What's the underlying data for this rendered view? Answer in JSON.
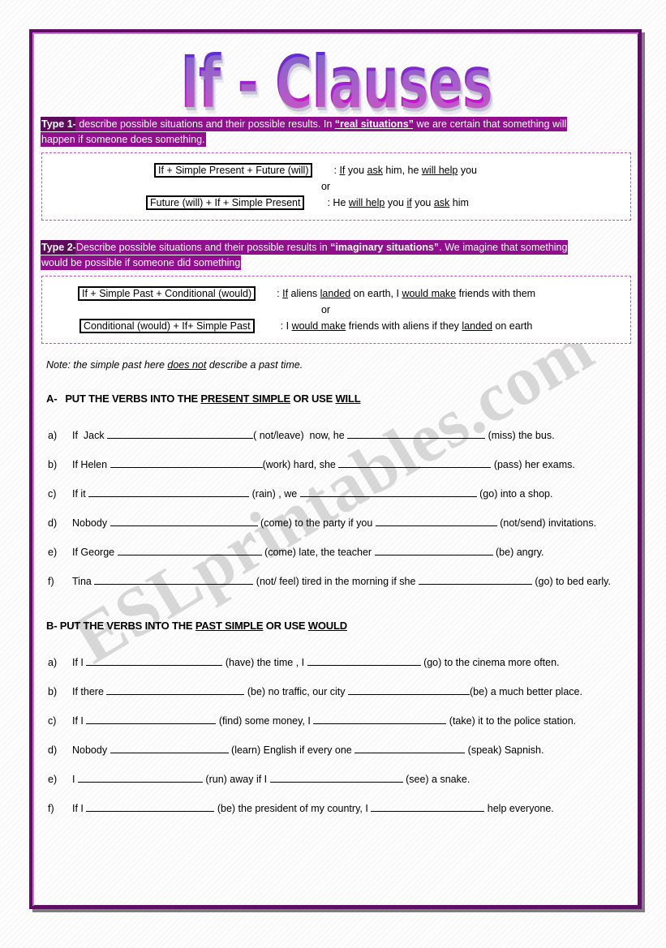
{
  "page": {
    "title": "If - Clauses",
    "watermark": "ESLprintables.com",
    "frame_color": "#5b1060",
    "highlight_color": "#8f0f8c",
    "tag_color": "#5e0a5c"
  },
  "type1": {
    "tag": "Type 1-",
    "text_a": " describe possible situations and their possible results. In ",
    "quoted": "“real situations”",
    "text_b": " we are certain that something will",
    "line2": "happen if someone does something."
  },
  "type1_box": {
    "pattern1": "If + Simple Present + Future (will)",
    "example1_pre": ": ",
    "example1": ": If you ask him, he will help you",
    "or": "or",
    "pattern2": "Future (will) + If + Simple Present",
    "example2": ": He will help you if you ask him"
  },
  "type2": {
    "tag": "Type 2-",
    "text_a": "Describe possible situations and their possible results in ",
    "quoted": "“imaginary situations”",
    "text_b": ". We imagine that something",
    "line2": "would be possible if someone did something"
  },
  "type2_box": {
    "pattern1": "If + Simple Past + Conditional (would)",
    "example1": ": If aliens landed on earth, I would make friends with them",
    "or": "or",
    "pattern2": "Conditional (would) + If+ Simple Past",
    "example2": ": I would make friends with aliens if they landed on earth"
  },
  "note": {
    "prefix": "Note: the simple past here ",
    "underlined": "does not",
    "suffix": " describe a past time."
  },
  "exercise_a": {
    "index": "A-",
    "heading_pre": "PUT THE VERBS INTO THE ",
    "heading_underline1": "PRESENT SIMPLE",
    "heading_mid": " OR USE ",
    "heading_underline2": "WILL",
    "items": [
      {
        "label": "a)",
        "p1": "If  Jack ",
        "b1": 180,
        "p2": "( not/leave)  now, he ",
        "b2": 170,
        "p3": " (miss) the bus."
      },
      {
        "label": "b)",
        "p1": "If Helen ",
        "b1": 188,
        "p2": "(work) hard, she ",
        "b2": 188,
        "p3": " (pass) her exams."
      },
      {
        "label": "c)",
        "p1": "If it ",
        "b1": 198,
        "p2": " (rain) , we ",
        "b2": 218,
        "p3": " (go) into a shop."
      },
      {
        "label": "d)",
        "p1": "Nobody ",
        "b1": 182,
        "p2": " (come) to the party if you ",
        "b2": 150,
        "p3": " (not/send) invitations."
      },
      {
        "label": "e)",
        "p1": "If George ",
        "b1": 178,
        "p2": " (come) late, the teacher ",
        "b2": 146,
        "p3": " (be) angry."
      },
      {
        "label": "f)",
        "p1": "Tina ",
        "b1": 196,
        "p2": " (not/ feel) tired in the morning if she ",
        "b2": 140,
        "p3": " (go) to bed early."
      }
    ]
  },
  "exercise_b": {
    "index": "B-",
    "heading_pre": " PUT THE VERBS INTO THE ",
    "heading_underline1": "PAST SIMPLE",
    "heading_mid": " OR USE ",
    "heading_underline2": "WOULD",
    "items": [
      {
        "label": "a)",
        "p1": "If I ",
        "b1": 168,
        "p2": " (have) the time , I ",
        "b2": 140,
        "p3": " (go) to the cinema more often."
      },
      {
        "label": "b)",
        "p1": "If there ",
        "b1": 170,
        "p2": " (be) no traffic, our city ",
        "b2": 150,
        "p3": "(be) a much better place."
      },
      {
        "label": "c)",
        "p1": "If I ",
        "b1": 160,
        "p2": " (find) some money, I ",
        "b2": 164,
        "p3": " (take) it to the police station."
      },
      {
        "label": "d)",
        "p1": "Nobody ",
        "b1": 146,
        "p2": " (learn) English if every one ",
        "b2": 136,
        "p3": " (speak) Sapnish."
      },
      {
        "label": "e)",
        "p1": "I ",
        "b1": 154,
        "p2": " (run) away if I ",
        "b2": 164,
        "p3": " (see) a snake."
      },
      {
        "label": "f)",
        "p1": "If I ",
        "b1": 158,
        "p2": " (be) the president of my country, I ",
        "b2": 140,
        "p3": " help everyone."
      }
    ]
  }
}
